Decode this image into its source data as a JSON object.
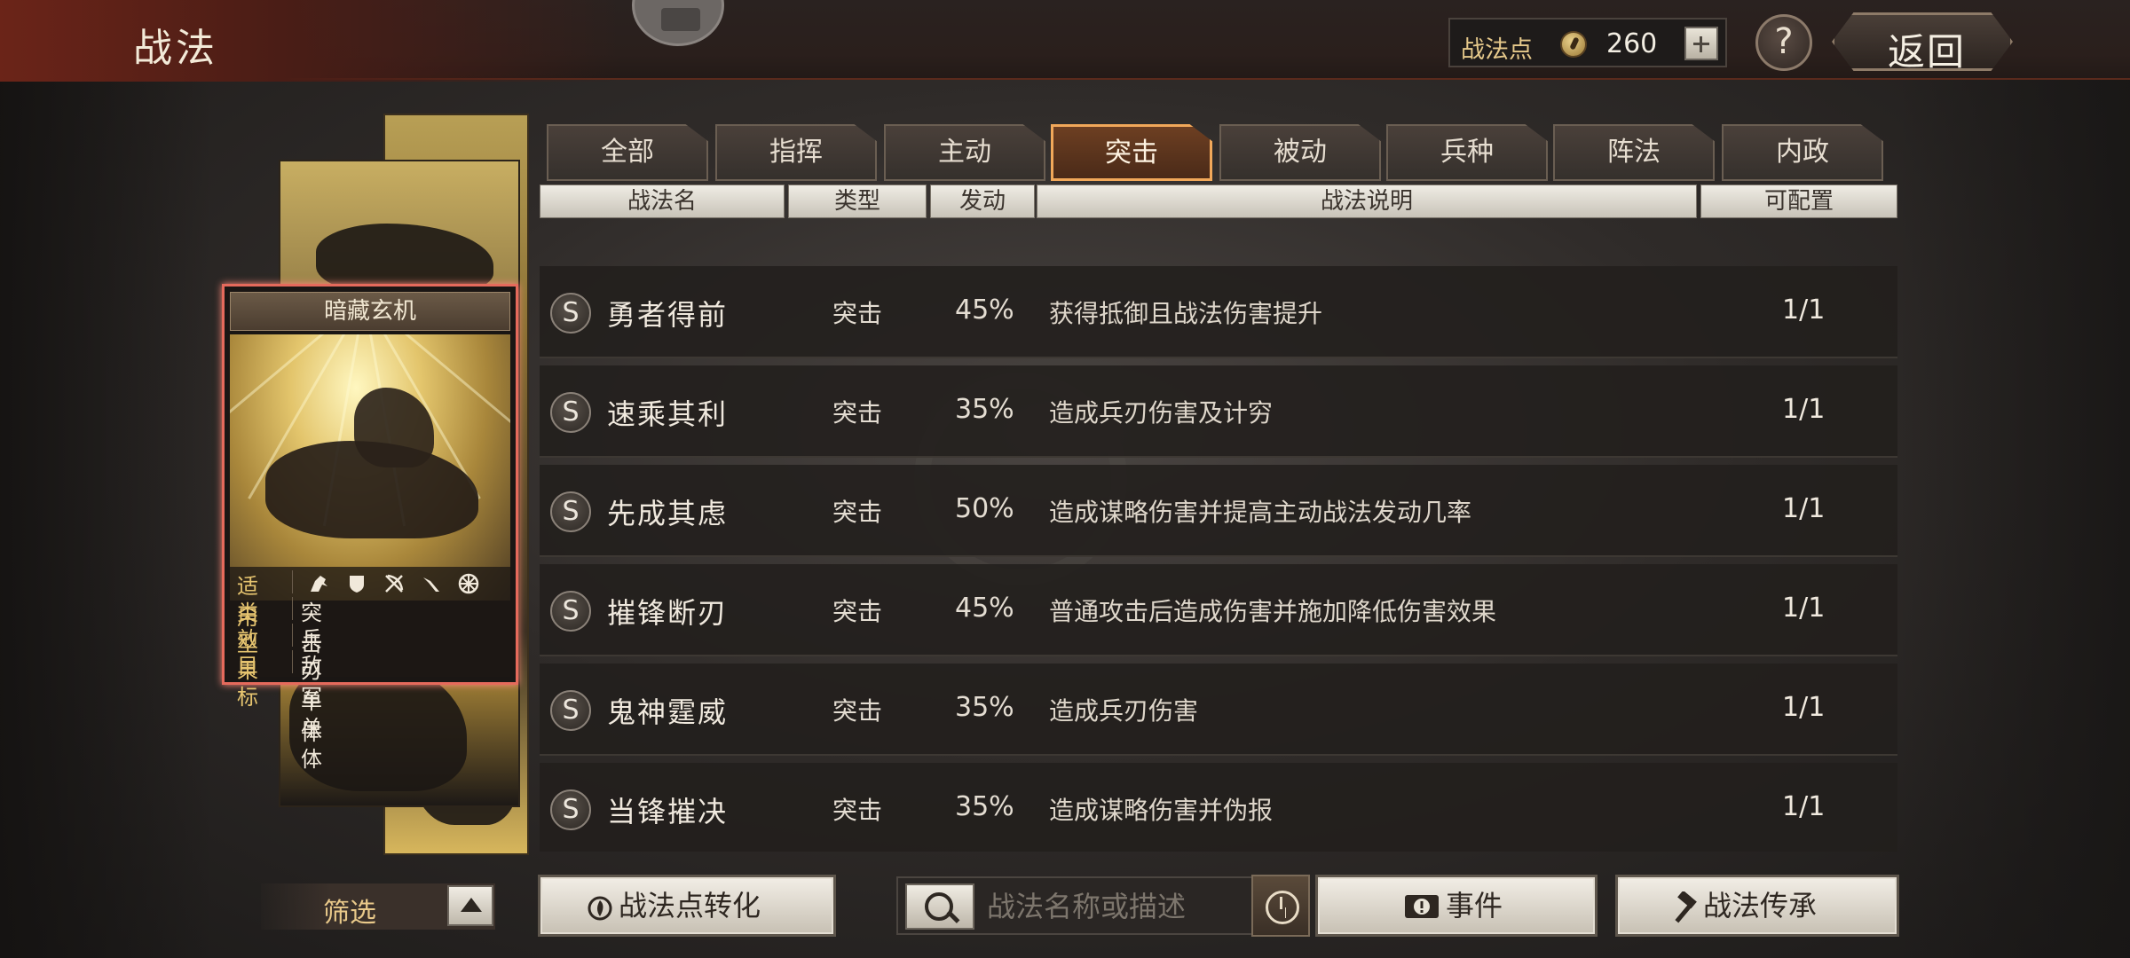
{
  "header": {
    "title": "战法",
    "points_label": "战法点",
    "points_value": "260",
    "help_label": "?",
    "back_label": "返回"
  },
  "tabs": [
    {
      "label": "全部",
      "active": false
    },
    {
      "label": "指挥",
      "active": false
    },
    {
      "label": "主动",
      "active": false
    },
    {
      "label": "突击",
      "active": true
    },
    {
      "label": "被动",
      "active": false
    },
    {
      "label": "兵种",
      "active": false
    },
    {
      "label": "阵法",
      "active": false
    },
    {
      "label": "内政",
      "active": false
    }
  ],
  "columns": {
    "name": "战法名",
    "type": "类型",
    "rate": "发动",
    "desc": "战法说明",
    "avail": "可配置"
  },
  "card": {
    "title": "暗藏玄机",
    "applies_label": "适用",
    "type_label": "类型",
    "type_value": "突击",
    "effect_label": "效果",
    "effect_value": "兵刃单体",
    "target_label": "目标",
    "target_value": "敌军单体",
    "unit_icons": [
      "cavalry-icon",
      "shield-icon",
      "bow-icon",
      "spear-icon",
      "siege-icon"
    ]
  },
  "tactics": [
    {
      "grade": "S",
      "name": "勇者得前",
      "type": "突击",
      "rate": "45%",
      "desc": "获得抵御且战法伤害提升",
      "avail": "1/1"
    },
    {
      "grade": "S",
      "name": "速乘其利",
      "type": "突击",
      "rate": "35%",
      "desc": "造成兵刃伤害及计穷",
      "avail": "1/1"
    },
    {
      "grade": "S",
      "name": "先成其虑",
      "type": "突击",
      "rate": "50%",
      "desc": "造成谋略伤害并提高主动战法发动几率",
      "avail": "1/1"
    },
    {
      "grade": "S",
      "name": "摧锋断刃",
      "type": "突击",
      "rate": "45%",
      "desc": "普通攻击后造成伤害并施加降低伤害效果",
      "avail": "1/1"
    },
    {
      "grade": "S",
      "name": "鬼神霆威",
      "type": "突击",
      "rate": "35%",
      "desc": "造成兵刃伤害",
      "avail": "1/1"
    },
    {
      "grade": "S",
      "name": "当锋摧决",
      "type": "突击",
      "rate": "35%",
      "desc": "造成谋略伤害并伪报",
      "avail": "1/1"
    }
  ],
  "bottom": {
    "filter_label": "筛选",
    "convert_label": "战法点转化",
    "search_placeholder": "战法名称或描述",
    "event_label": "事件",
    "inherit_label": "战法传承"
  },
  "colors": {
    "active_tab_border": "#f1a85a",
    "card_highlight": "#e56a5c",
    "accent_gold": "#e6c46f"
  }
}
